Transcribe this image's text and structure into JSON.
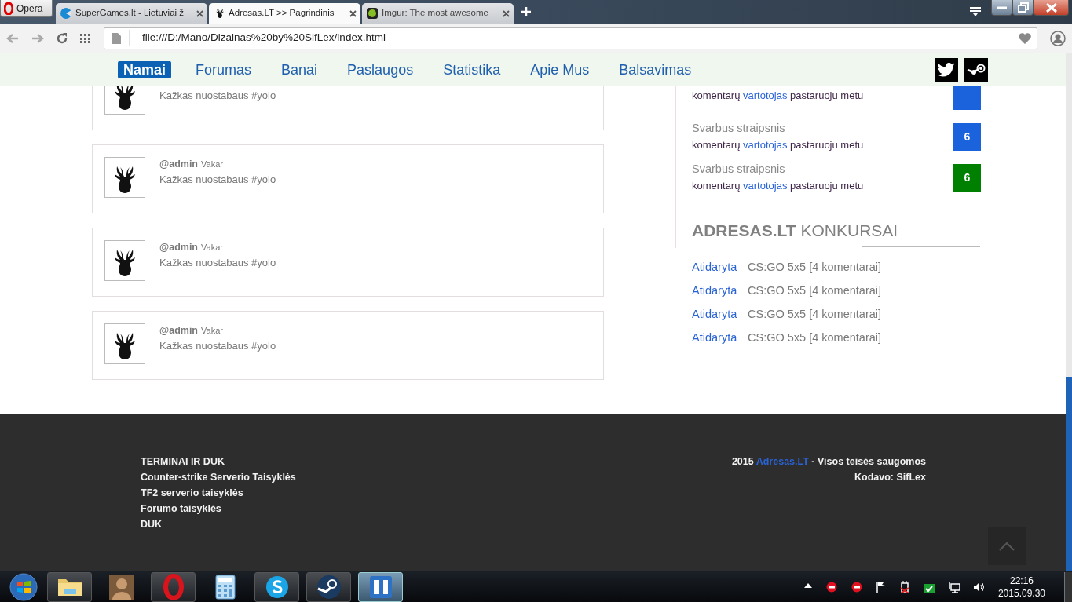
{
  "browser": {
    "menu_button": "Opera",
    "tabs": [
      {
        "kind": "pacman",
        "title": "SuperGames.lt - Lietuviai ž",
        "selected": false
      },
      {
        "kind": "deer",
        "title": "Adresas.LT >> Pagrindinis",
        "selected": true
      },
      {
        "kind": "dot",
        "title": "Imgur: The most awesome",
        "selected": false
      }
    ],
    "address": "file:///D:/Mano/Dizainas%20by%20SifLex/index.html"
  },
  "nav": {
    "items": [
      {
        "label": "Namai",
        "selected": true
      },
      {
        "label": "Forumas",
        "selected": false
      },
      {
        "label": "Banai",
        "selected": false
      },
      {
        "label": "Paslaugos",
        "selected": false
      },
      {
        "label": "Statistika",
        "selected": false
      },
      {
        "label": "Apie Mus",
        "selected": false
      },
      {
        "label": "Balsavimas",
        "selected": false
      }
    ]
  },
  "posts": [
    {
      "text": "Kažkas nuostabaus #yolo"
    },
    {
      "user": "@admin",
      "time": "Vakar",
      "text": "Kažkas nuostabaus #yolo"
    },
    {
      "user": "@admin",
      "time": "Vakar",
      "text": "Kažkas nuostabaus #yolo"
    },
    {
      "user": "@admin",
      "time": "Vakar",
      "text": "Kažkas nuostabaus #yolo"
    }
  ],
  "articles": [
    {
      "prefix": "komentarų",
      "user": "vartotojas",
      "suffix": "pastaruoju metu",
      "color": "#1a63dc"
    },
    {
      "title": "Svarbus straipsnis",
      "prefix": "komentarų",
      "user": "vartotojas",
      "suffix": "pastaruoju metu",
      "count": "6",
      "color": "#1a63dc"
    },
    {
      "title": "Svarbus straipsnis",
      "prefix": "komentarų",
      "user": "vartotojas",
      "suffix": "pastaruoju metu",
      "count": "6",
      "color": "#008000"
    }
  ],
  "contests": {
    "heading": "**ADRESAS.LT** KONKURSAI",
    "rows": [
      {
        "status": "Atidaryta",
        "text": "CS:GO 5x5 [4 komentarai]"
      },
      {
        "status": "Atidaryta",
        "text": "CS:GO 5x5 [4 komentarai]"
      },
      {
        "status": "Atidaryta",
        "text": "CS:GO 5x5 [4 komentarai]"
      },
      {
        "status": "Atidaryta",
        "text": "CS:GO 5x5 [4 komentarai]"
      }
    ]
  },
  "footer": {
    "heading": "TERMINAI IR DUK",
    "links": [
      "Counter-strike Serverio Taisyklės",
      "TF2 serverio taisyklės",
      "Forumo taisyklės",
      "DUK"
    ],
    "copyright_prefix": "2015",
    "copyright_link": "Adresas.LT",
    "copyright_suffix": "- Visos teisės saugomos",
    "credit": "Kodavo: SifLex"
  },
  "taskbar": {
    "apps": [
      {
        "kind": "folder",
        "running": true,
        "selected": false
      },
      {
        "kind": "figure",
        "running": false,
        "selected": false
      },
      {
        "kind": "opera",
        "running": true,
        "selected": false
      },
      {
        "kind": "calculator",
        "running": false,
        "selected": false
      },
      {
        "kind": "skype",
        "running": true,
        "selected": false
      },
      {
        "kind": "steam",
        "running": true,
        "selected": false
      },
      {
        "kind": "brackets",
        "running": true,
        "selected": true
      }
    ],
    "time": "22:16",
    "date": "2015.09.30"
  }
}
